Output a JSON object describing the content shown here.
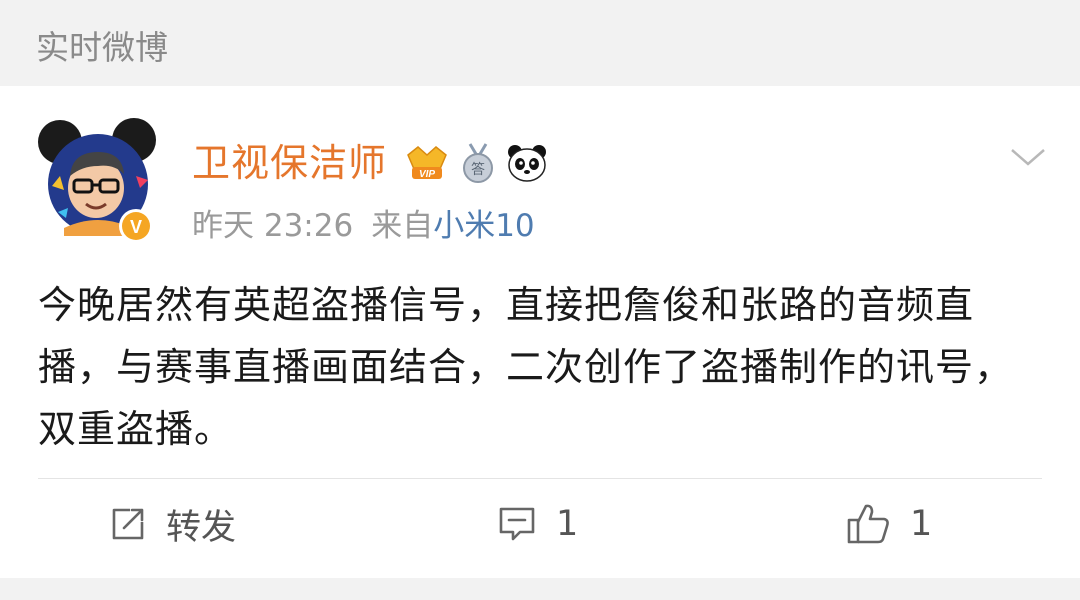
{
  "header": {
    "title": "实时微博"
  },
  "post": {
    "author": {
      "name": "卫视保洁师",
      "verified_badge": "V",
      "badges": [
        "vip-crown-icon",
        "medal-icon",
        "panda-icon"
      ],
      "vip_label": "VIP",
      "medal_label": "答"
    },
    "meta": {
      "time": "昨天 23:26",
      "source_prefix": "来自",
      "device": "小米10"
    },
    "text": "今晚居然有英超盗播信号，直接把詹俊和张路的音频直播，与赛事直播画面结合，二次创作了盗播制作的讯号，双重盗播。"
  },
  "actions": {
    "repost_label": "转发",
    "comment_count": "1",
    "like_count": "1"
  },
  "colors": {
    "background": "#f2f2f2",
    "username": "#e5762c",
    "device_link": "#4f7cb0",
    "meta_text": "#9a9a9a",
    "verified": "#f5a623"
  }
}
